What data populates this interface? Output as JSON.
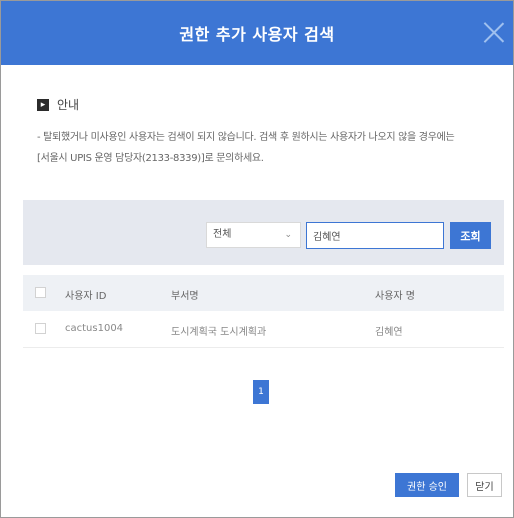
{
  "dialog": {
    "title": "권한 추가 사용자 검색"
  },
  "notice": {
    "heading": "안내",
    "line1": "- 탈퇴했거나 미사용인 사용자는 검색이 되지 않습니다. 검색 후 원하시는 사용자가 나오지 않을 경우에는",
    "line2": "[서울시 UPIS 운영 담당자(2133-8339)]로 문의하세요."
  },
  "search": {
    "scope_selected": "전체",
    "query": "김혜연",
    "button_label": "조회"
  },
  "table": {
    "headers": [
      "사용자 ID",
      "부서명",
      "사용자 명"
    ],
    "rows": [
      {
        "user_id": "cactus1004",
        "department": "도시계획국 도시계획과",
        "name": "김혜연"
      }
    ]
  },
  "pagination": {
    "current_page": "1"
  },
  "footer": {
    "approve_label": "권한 승인",
    "close_label": "닫기"
  },
  "colors": {
    "accent": "#3d76d4",
    "search_bar_bg": "#e5e8ef"
  },
  "icons": {
    "close": "close-icon",
    "notice": "arrow-right-icon",
    "select_caret": "chevron-down-icon"
  }
}
